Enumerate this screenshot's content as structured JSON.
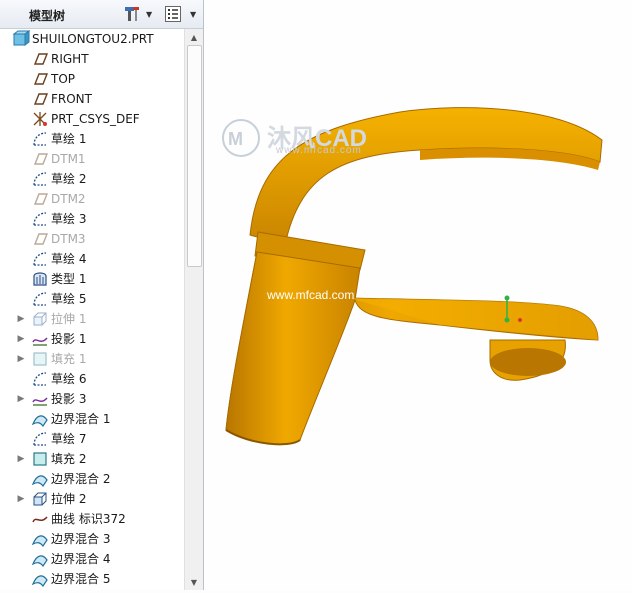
{
  "model_tree": {
    "title": "模型树",
    "root": "SHUILONGTOU2.PRT",
    "items": [
      {
        "label": "RIGHT",
        "icon": "datum-plane-icon",
        "expandable": false,
        "suppressed": false
      },
      {
        "label": "TOP",
        "icon": "datum-plane-icon",
        "expandable": false,
        "suppressed": false
      },
      {
        "label": "FRONT",
        "icon": "datum-plane-icon",
        "expandable": false,
        "suppressed": false
      },
      {
        "label": "PRT_CSYS_DEF",
        "icon": "csys-icon",
        "expandable": false,
        "suppressed": false
      },
      {
        "label": "草绘 1",
        "icon": "sketch-icon",
        "expandable": false,
        "suppressed": false
      },
      {
        "label": "DTM1",
        "icon": "datum-plane-icon",
        "expandable": false,
        "suppressed": true
      },
      {
        "label": "草绘 2",
        "icon": "sketch-icon",
        "expandable": false,
        "suppressed": false
      },
      {
        "label": "DTM2",
        "icon": "datum-plane-icon",
        "expandable": false,
        "suppressed": true
      },
      {
        "label": "草绘 3",
        "icon": "sketch-icon",
        "expandable": false,
        "suppressed": false
      },
      {
        "label": "DTM3",
        "icon": "datum-plane-icon",
        "expandable": false,
        "suppressed": true
      },
      {
        "label": "草绘 4",
        "icon": "sketch-icon",
        "expandable": false,
        "suppressed": false
      },
      {
        "label": "类型 1",
        "icon": "style-icon",
        "expandable": false,
        "suppressed": false
      },
      {
        "label": "草绘 5",
        "icon": "sketch-icon",
        "expandable": false,
        "suppressed": false
      },
      {
        "label": "拉伸 1",
        "icon": "extrude-icon",
        "expandable": true,
        "suppressed": true
      },
      {
        "label": "投影 1",
        "icon": "projection-icon",
        "expandable": true,
        "suppressed": false
      },
      {
        "label": "填充 1",
        "icon": "fill-icon",
        "expandable": true,
        "suppressed": true
      },
      {
        "label": "草绘 6",
        "icon": "sketch-icon",
        "expandable": false,
        "suppressed": false
      },
      {
        "label": "投影 3",
        "icon": "projection-icon",
        "expandable": true,
        "suppressed": false
      },
      {
        "label": "边界混合 1",
        "icon": "boundary-blend-icon",
        "expandable": false,
        "suppressed": false
      },
      {
        "label": "草绘 7",
        "icon": "sketch-icon",
        "expandable": false,
        "suppressed": false
      },
      {
        "label": "填充 2",
        "icon": "fill-icon",
        "expandable": true,
        "suppressed": false
      },
      {
        "label": "边界混合 2",
        "icon": "boundary-blend-icon",
        "expandable": false,
        "suppressed": false
      },
      {
        "label": "拉伸 2",
        "icon": "extrude-icon",
        "expandable": true,
        "suppressed": false
      },
      {
        "label": "曲线 标识372",
        "icon": "curve-icon",
        "expandable": false,
        "suppressed": false
      },
      {
        "label": "边界混合 3",
        "icon": "boundary-blend-icon",
        "expandable": false,
        "suppressed": false
      },
      {
        "label": "边界混合 4",
        "icon": "boundary-blend-icon",
        "expandable": false,
        "suppressed": false
      },
      {
        "label": "边界混合 5",
        "icon": "boundary-blend-icon",
        "expandable": false,
        "suppressed": false
      }
    ]
  },
  "toolbar_icons": [
    "settings-tools-icon",
    "dropdown-icon",
    "show-columns-icon",
    "dropdown-icon"
  ],
  "viewport": {
    "watermark_brand": "沐风CAD",
    "watermark_url": "www.mfcad.com",
    "watermark_center": "www.mfcad.com",
    "model_color": "#e8a000",
    "model_shadow": "#a86a00"
  }
}
